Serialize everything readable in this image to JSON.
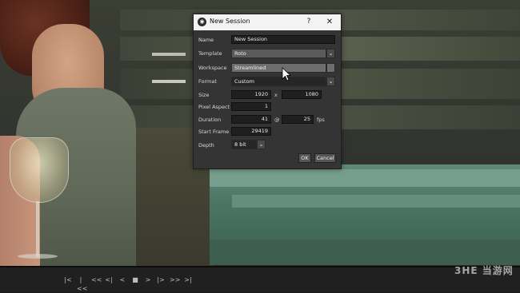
{
  "dialog": {
    "title": "New Session",
    "help_label": "?",
    "close_label": "✕",
    "fields": {
      "name": {
        "label": "Name",
        "value": "New Session"
      },
      "template": {
        "label": "Template",
        "value": "Roto"
      },
      "workspace": {
        "label": "Workspace",
        "value": "Streamlined"
      },
      "format": {
        "label": "Format",
        "value": "Custom"
      },
      "size": {
        "label": "Size",
        "width": "1920",
        "separator": "x",
        "height": "1080"
      },
      "pixel_aspect": {
        "label": "Pixel Aspect",
        "value": "1"
      },
      "duration": {
        "label": "Duration",
        "frames": "41",
        "at": "@",
        "fps_value": "25",
        "fps_unit": "fps"
      },
      "start_frame": {
        "label": "Start Frame",
        "value": "29419"
      },
      "depth": {
        "label": "Depth",
        "value": "8 bit"
      }
    },
    "ok_label": "OK",
    "cancel_label": "Cancel"
  },
  "transport": {
    "buttons": [
      "|<",
      "|<<",
      "<<",
      "<|",
      "<",
      "■",
      ">",
      "|>",
      ">>",
      ">|"
    ]
  },
  "watermark": "3HE 当游网"
}
